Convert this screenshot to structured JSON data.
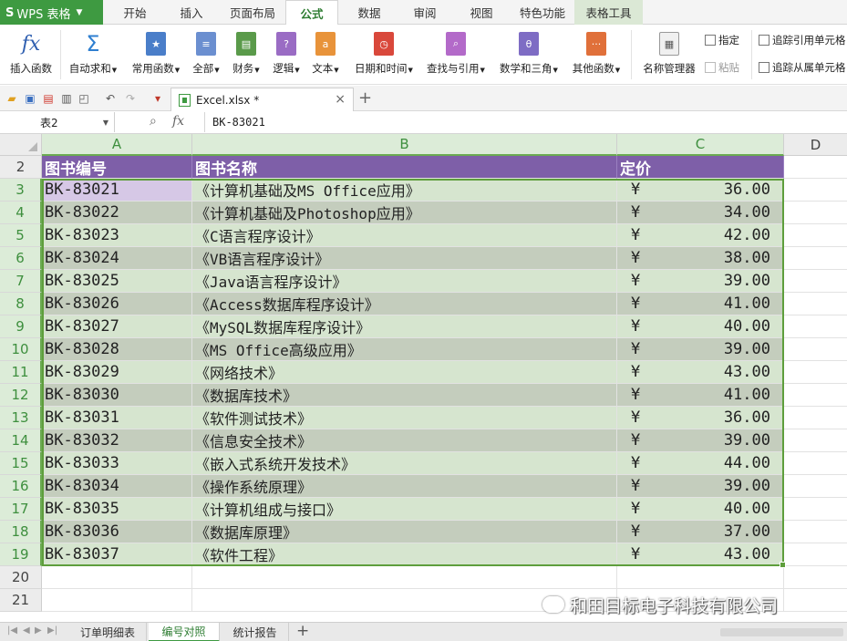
{
  "app": {
    "brand": "WPS 表格",
    "logo": "S"
  },
  "tabs": [
    {
      "label": "开始"
    },
    {
      "label": "插入"
    },
    {
      "label": "页面布局"
    },
    {
      "label": "公式",
      "active": true
    },
    {
      "label": "数据"
    },
    {
      "label": "审阅"
    },
    {
      "label": "视图"
    },
    {
      "label": "特色功能"
    },
    {
      "label": "表格工具"
    }
  ],
  "ribbon": {
    "insert_function": "插入函数",
    "autosum": "自动求和",
    "common": "常用函数",
    "all": "全部",
    "finance": "财务",
    "logic": "逻辑",
    "text": "文本",
    "datetime": "日期和时间",
    "lookup": "查找与引用",
    "math": "数学和三角",
    "other": "其他函数",
    "name_manager": "名称管理器",
    "specify": "指定",
    "paste": "粘贴",
    "trace_precedents": "追踪引用单元格",
    "trace_dependents": "追踪从属单元格",
    "icon_colors": {
      "common": "#4a7ec9",
      "all": "#6b8fd0",
      "finance": "#5a9a4a",
      "logic": "#9a6cc4",
      "text": "#e8933a",
      "datetime": "#d9483b",
      "lookup": "#b36ac9",
      "math": "#7e6cc4",
      "other": "#e0703a"
    }
  },
  "doc": {
    "filename": "Excel.xlsx *"
  },
  "formula_bar": {
    "name_box": "表2",
    "value": "BK-83021"
  },
  "grid": {
    "columns": [
      "A",
      "B",
      "C",
      "D"
    ],
    "header_row_number": "2",
    "headers": [
      "图书编号",
      "图书名称",
      "定价"
    ],
    "currency": "¥",
    "rows": [
      {
        "n": "3",
        "id": "BK-83021",
        "name": "《计算机基础及MS Office应用》",
        "price": "36.00"
      },
      {
        "n": "4",
        "id": "BK-83022",
        "name": "《计算机基础及Photoshop应用》",
        "price": "34.00"
      },
      {
        "n": "5",
        "id": "BK-83023",
        "name": "《C语言程序设计》",
        "price": "42.00"
      },
      {
        "n": "6",
        "id": "BK-83024",
        "name": "《VB语言程序设计》",
        "price": "38.00"
      },
      {
        "n": "7",
        "id": "BK-83025",
        "name": "《Java语言程序设计》",
        "price": "39.00"
      },
      {
        "n": "8",
        "id": "BK-83026",
        "name": "《Access数据库程序设计》",
        "price": "41.00"
      },
      {
        "n": "9",
        "id": "BK-83027",
        "name": "《MySQL数据库程序设计》",
        "price": "40.00"
      },
      {
        "n": "10",
        "id": "BK-83028",
        "name": "《MS Office高级应用》",
        "price": "39.00"
      },
      {
        "n": "11",
        "id": "BK-83029",
        "name": "《网络技术》",
        "price": "43.00"
      },
      {
        "n": "12",
        "id": "BK-83030",
        "name": "《数据库技术》",
        "price": "41.00"
      },
      {
        "n": "13",
        "id": "BK-83031",
        "name": "《软件测试技术》",
        "price": "36.00"
      },
      {
        "n": "14",
        "id": "BK-83032",
        "name": "《信息安全技术》",
        "price": "39.00"
      },
      {
        "n": "15",
        "id": "BK-83033",
        "name": "《嵌入式系统开发技术》",
        "price": "44.00"
      },
      {
        "n": "16",
        "id": "BK-83034",
        "name": "《操作系统原理》",
        "price": "39.00"
      },
      {
        "n": "17",
        "id": "BK-83035",
        "name": "《计算机组成与接口》",
        "price": "40.00"
      },
      {
        "n": "18",
        "id": "BK-83036",
        "name": "《数据库原理》",
        "price": "37.00"
      },
      {
        "n": "19",
        "id": "BK-83037",
        "name": "《软件工程》",
        "price": "43.00"
      }
    ],
    "empty_rows": [
      "20",
      "21"
    ],
    "colors": {
      "header_bg": "#7e5fa8",
      "band_light": "#d6e5cf",
      "band_dark": "#c4cdbd",
      "selection": "#5e9e3c",
      "active_cell": "#d6c8e6"
    }
  },
  "sheets": [
    {
      "label": "订单明细表"
    },
    {
      "label": "编号对照",
      "active": true
    },
    {
      "label": "统计报告"
    }
  ],
  "watermark": "和田目标电子科技有限公司"
}
